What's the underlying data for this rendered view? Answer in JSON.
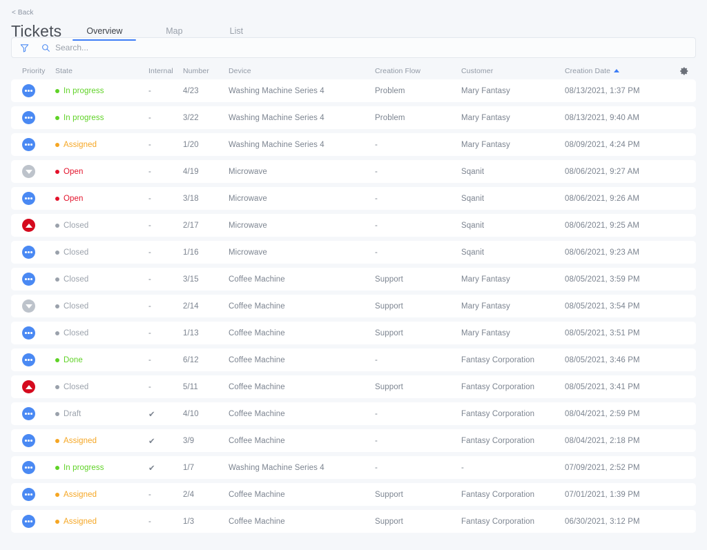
{
  "header": {
    "back_label": "< Back",
    "title": "Tickets",
    "tabs": [
      {
        "label": "Overview",
        "active": true
      },
      {
        "label": "Map",
        "active": false
      },
      {
        "label": "List",
        "active": false
      }
    ]
  },
  "search": {
    "placeholder": "Search...",
    "value": "",
    "filter_icon": "funnel-icon",
    "search_icon": "magnifier-icon"
  },
  "table": {
    "settings_icon": "gear-icon",
    "sort_column": "Creation Date",
    "sort_direction": "asc",
    "columns": [
      {
        "key": "priority",
        "label": "Priority"
      },
      {
        "key": "state",
        "label": "State"
      },
      {
        "key": "internal",
        "label": "Internal"
      },
      {
        "key": "number",
        "label": "Number"
      },
      {
        "key": "device",
        "label": "Device"
      },
      {
        "key": "flow",
        "label": "Creation Flow"
      },
      {
        "key": "customer",
        "label": "Customer"
      },
      {
        "key": "date",
        "label": "Creation Date"
      }
    ],
    "state_colors": {
      "In progress": "#5fd226",
      "Assigned": "#f5a623",
      "Open": "#e3112a",
      "Done": "#5fd226",
      "Closed": "#9aa1ab",
      "Draft": "#9aa1ab"
    },
    "priority_colors": {
      "medium": "#4a89f3",
      "low": "#bdc3cb",
      "high": "#d50a1e"
    },
    "rows": [
      {
        "priority": "medium",
        "priority_icon": "priority-medium-icon",
        "state": "In progress",
        "internal": "-",
        "number": "4/23",
        "device": "Washing Machine Series 4",
        "flow": "Problem",
        "customer": "Mary Fantasy",
        "date": "08/13/2021, 1:37 PM"
      },
      {
        "priority": "medium",
        "priority_icon": "priority-medium-icon",
        "state": "In progress",
        "internal": "-",
        "number": "3/22",
        "device": "Washing Machine Series 4",
        "flow": "Problem",
        "customer": "Mary Fantasy",
        "date": "08/13/2021, 9:40 AM"
      },
      {
        "priority": "medium",
        "priority_icon": "priority-medium-icon",
        "state": "Assigned",
        "internal": "-",
        "number": "1/20",
        "device": "Washing Machine Series 4",
        "flow": "-",
        "customer": "Mary Fantasy",
        "date": "08/09/2021, 4:24 PM"
      },
      {
        "priority": "low",
        "priority_icon": "priority-low-icon",
        "state": "Open",
        "internal": "-",
        "number": "4/19",
        "device": "Microwave",
        "flow": "-",
        "customer": "Sqanit",
        "date": "08/06/2021, 9:27 AM"
      },
      {
        "priority": "medium",
        "priority_icon": "priority-medium-icon",
        "state": "Open",
        "internal": "-",
        "number": "3/18",
        "device": "Microwave",
        "flow": "-",
        "customer": "Sqanit",
        "date": "08/06/2021, 9:26 AM"
      },
      {
        "priority": "high",
        "priority_icon": "priority-high-icon",
        "state": "Closed",
        "internal": "-",
        "number": "2/17",
        "device": "Microwave",
        "flow": "-",
        "customer": "Sqanit",
        "date": "08/06/2021, 9:25 AM"
      },
      {
        "priority": "medium",
        "priority_icon": "priority-medium-icon",
        "state": "Closed",
        "internal": "-",
        "number": "1/16",
        "device": "Microwave",
        "flow": "-",
        "customer": "Sqanit",
        "date": "08/06/2021, 9:23 AM"
      },
      {
        "priority": "medium",
        "priority_icon": "priority-medium-icon",
        "state": "Closed",
        "internal": "-",
        "number": "3/15",
        "device": "Coffee Machine",
        "flow": "Support",
        "customer": "Mary Fantasy",
        "date": "08/05/2021, 3:59 PM"
      },
      {
        "priority": "low",
        "priority_icon": "priority-low-icon",
        "state": "Closed",
        "internal": "-",
        "number": "2/14",
        "device": "Coffee Machine",
        "flow": "Support",
        "customer": "Mary Fantasy",
        "date": "08/05/2021, 3:54 PM"
      },
      {
        "priority": "medium",
        "priority_icon": "priority-medium-icon",
        "state": "Closed",
        "internal": "-",
        "number": "1/13",
        "device": "Coffee Machine",
        "flow": "Support",
        "customer": "Mary Fantasy",
        "date": "08/05/2021, 3:51 PM"
      },
      {
        "priority": "medium",
        "priority_icon": "priority-medium-icon",
        "state": "Done",
        "internal": "-",
        "number": "6/12",
        "device": "Coffee Machine",
        "flow": "-",
        "customer": "Fantasy Corporation",
        "date": "08/05/2021, 3:46 PM"
      },
      {
        "priority": "high",
        "priority_icon": "priority-high-icon",
        "state": "Closed",
        "internal": "-",
        "number": "5/11",
        "device": "Coffee Machine",
        "flow": "Support",
        "customer": "Fantasy Corporation",
        "date": "08/05/2021, 3:41 PM"
      },
      {
        "priority": "medium",
        "priority_icon": "priority-medium-icon",
        "state": "Draft",
        "internal": "✔",
        "number": "4/10",
        "device": "Coffee Machine",
        "flow": "-",
        "customer": "Fantasy Corporation",
        "date": "08/04/2021, 2:59 PM"
      },
      {
        "priority": "medium",
        "priority_icon": "priority-medium-icon",
        "state": "Assigned",
        "internal": "✔",
        "number": "3/9",
        "device": "Coffee Machine",
        "flow": "-",
        "customer": "Fantasy Corporation",
        "date": "08/04/2021, 2:18 PM"
      },
      {
        "priority": "medium",
        "priority_icon": "priority-medium-icon",
        "state": "In progress",
        "internal": "✔",
        "number": "1/7",
        "device": "Washing Machine Series 4",
        "flow": "-",
        "customer": "-",
        "date": "07/09/2021, 2:52 PM"
      },
      {
        "priority": "medium",
        "priority_icon": "priority-medium-icon",
        "state": "Assigned",
        "internal": "-",
        "number": "2/4",
        "device": "Coffee Machine",
        "flow": "Support",
        "customer": "Fantasy Corporation",
        "date": "07/01/2021, 1:39 PM"
      },
      {
        "priority": "medium",
        "priority_icon": "priority-medium-icon",
        "state": "Assigned",
        "internal": "-",
        "number": "1/3",
        "device": "Coffee Machine",
        "flow": "Support",
        "customer": "Fantasy Corporation",
        "date": "06/30/2021, 3:12 PM"
      }
    ]
  },
  "colors": {
    "accent": "#3d7df6",
    "background": "#f5f7fa",
    "row_background": "#ffffff"
  }
}
